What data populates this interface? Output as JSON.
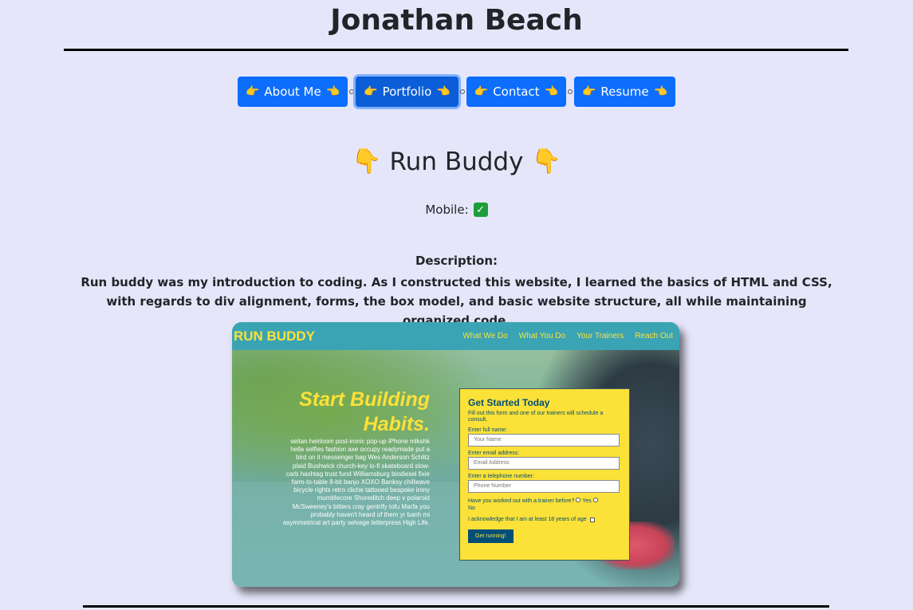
{
  "header": {
    "title": "Jonathan Beach"
  },
  "nav": {
    "items": [
      {
        "label": "About Me",
        "active": false
      },
      {
        "label": "Portfolio",
        "active": true
      },
      {
        "label": "Contact",
        "active": false
      },
      {
        "label": "Resume",
        "active": false
      }
    ],
    "hand_left": "👉",
    "hand_right": "👈"
  },
  "project": {
    "title": "Run Buddy",
    "title_icon": "👇",
    "mobile_label": "Mobile:",
    "mobile_icon": "✓",
    "description_label": "Description:",
    "description": "Run buddy was my introduction to coding. As I constructed this website, I learned the basics of HTML and CSS, with regards to div alignment, forms, the box model, and basic website structure, all while maintaining organized code."
  },
  "screenshot": {
    "logo": "RUN BUDDY",
    "nav": [
      "What We Do",
      "What You Do",
      "Your Trainers",
      "Reach Out"
    ],
    "hero_title_line1": "Start Building",
    "hero_title_line2": "Habits.",
    "hero_text": "seitan heirloom post-ironic pop-up iPhone mlkshk hella selfies fashion axe occupy readymade put a bird on it messenger bag Wes Anderson Schlitz plaid Bushwick church-key lo-fi skateboard slow-carb hashtag trust fund Williamsburg biodiesel fixie farm-to-table 8-bit banjo XOXO Banksy chillwave bicycle rights retro cliche tattooed bespoke irony mumblecore Shoreditch deep v polaroid McSweeney's bitters cray gentrify tofu Marfa you probably haven't heard of them yr banh mi asymmetrical art party selvage letterpress High Life.",
    "form": {
      "title": "Get Started Today",
      "subtitle": "Fill out this form and one of our trainers will schedule a consult.",
      "name_label": "Enter full name:",
      "name_placeholder": "Your Name",
      "email_label": "Enter email address:",
      "email_placeholder": "Email Address",
      "phone_label": "Enter a telephone number:",
      "phone_placeholder": "Phone Number",
      "trainer_question": "Have you worked out with a trainer before?",
      "yes": "Yes",
      "no": "No",
      "acknowledge": "I acknowledge that I am at least 18 years of age",
      "button": "Get running!"
    }
  },
  "colors": {
    "page_bg": "#e6e6fa",
    "nav_button": "#0d6efd",
    "runbuddy_yellow": "#fce138",
    "runbuddy_blue": "#024e76"
  }
}
